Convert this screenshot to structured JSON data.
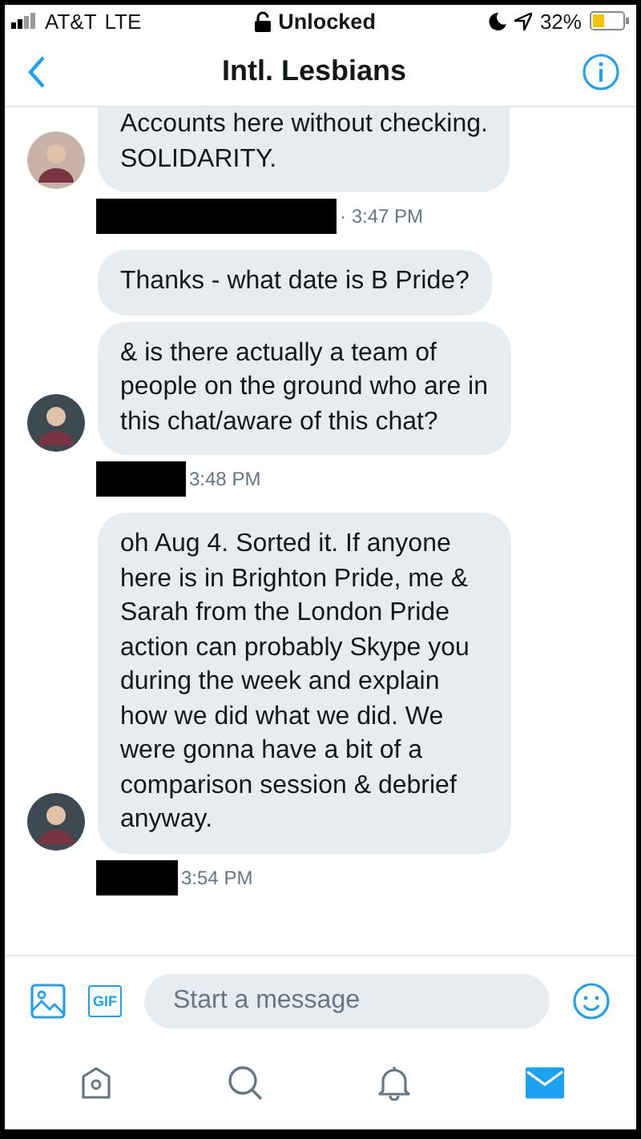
{
  "status_bar": {
    "carrier": "AT&T",
    "network": "LTE",
    "lock": "Unlocked",
    "battery": "32%"
  },
  "header": {
    "title": "Intl. Lesbians"
  },
  "groups": [
    {
      "messages": [
        "Accounts here without checking.\nSOLIDARITY."
      ],
      "time": "· 3:47 PM"
    },
    {
      "messages": [
        "Thanks - what date is B Pride?",
        "& is there actually a team of people on the ground who are in this chat/aware of this chat?"
      ],
      "time": "3:48 PM"
    },
    {
      "messages": [
        "oh Aug 4. Sorted it. If anyone here is in Brighton Pride, me & Sarah from the London Pride action can probably Skype you during the week and explain how we did what we did. We were gonna have a bit of a comparison session & debrief anyway."
      ],
      "time": "3:54 PM"
    }
  ],
  "composer": {
    "gif": "GIF",
    "placeholder": "Start a message"
  },
  "tab_bar": [
    {
      "kind": "home",
      "selected": false
    },
    {
      "kind": "search",
      "selected": false
    },
    {
      "kind": "notifications",
      "selected": false
    },
    {
      "kind": "messages",
      "selected": true
    }
  ]
}
